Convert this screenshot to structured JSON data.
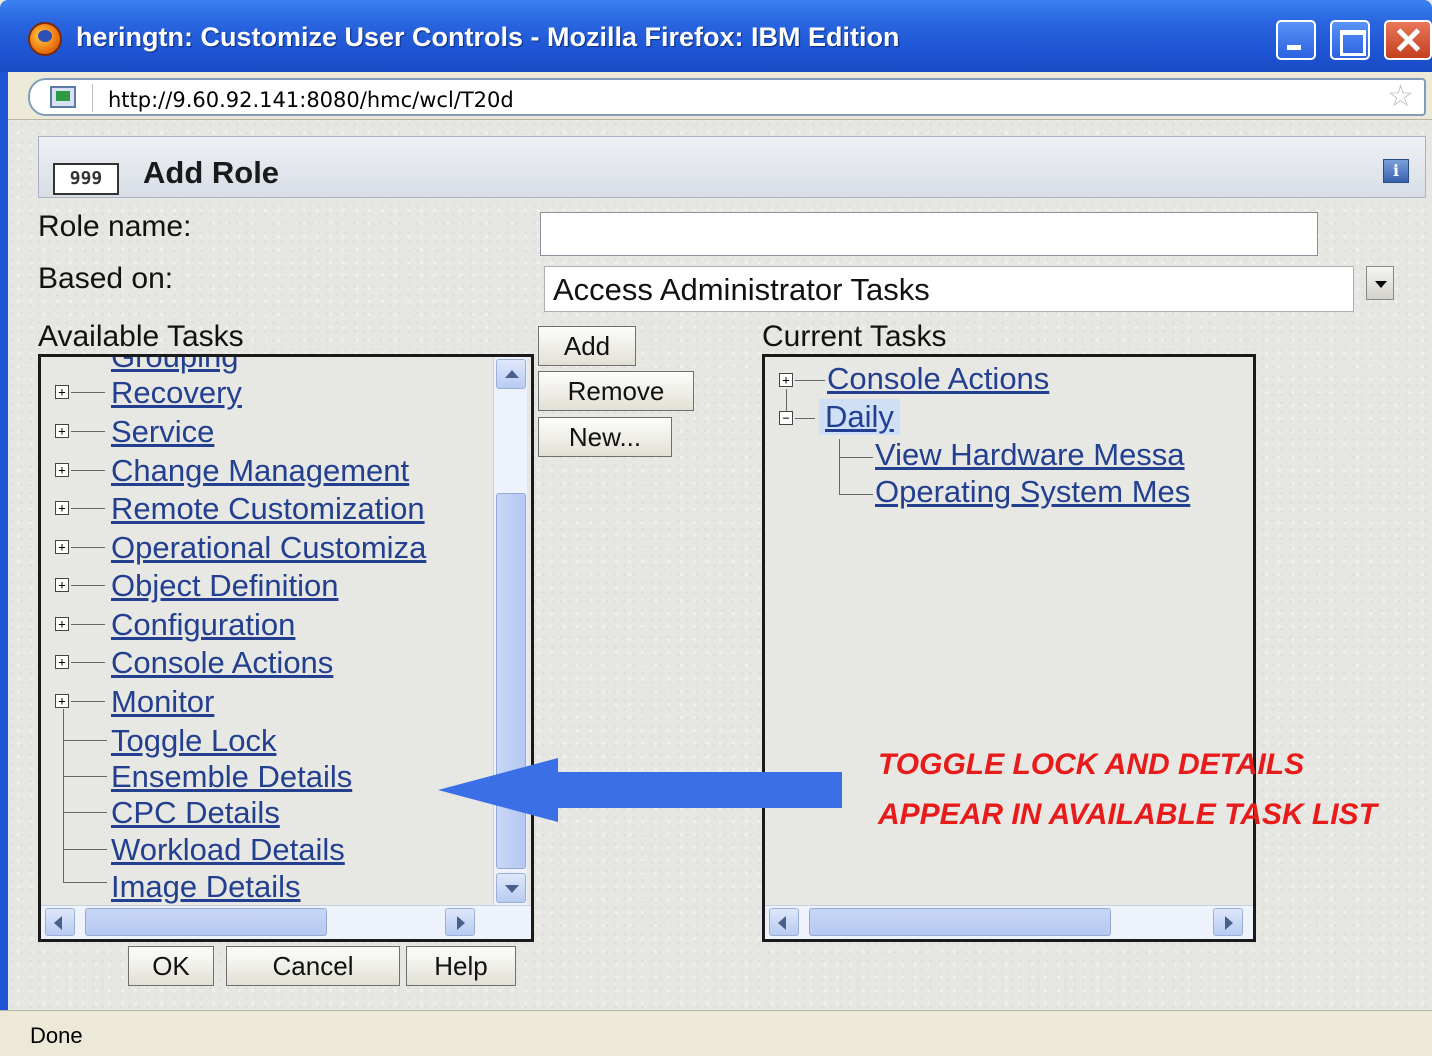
{
  "window": {
    "title": "heringtn: Customize User Controls - Mozilla Firefox: IBM Edition"
  },
  "urlbar": {
    "url": "http://9.60.92.141:8080/hmc/wcl/T20d"
  },
  "dialog": {
    "header_title": "Add Role",
    "role_icon_text": "999",
    "role_name_label": "Role name:",
    "role_name_value": "",
    "based_on_label": "Based on:",
    "based_on_value": "Access Administrator Tasks",
    "available_label": "Available Tasks",
    "current_label": "Current Tasks",
    "available_items": [
      "Grouping",
      "Recovery",
      "Service",
      "Change Management",
      "Remote Customization",
      "Operational Customiza",
      "Object Definition",
      "Configuration",
      "Console Actions",
      "Monitor",
      "Toggle Lock",
      "Ensemble Details",
      "CPC Details",
      "Workload Details",
      "Image Details"
    ],
    "current_items": [
      "Console Actions",
      "Daily",
      "View Hardware Messa",
      "Operating System Mes"
    ],
    "buttons": {
      "add": "Add",
      "remove": "Remove",
      "new": "New...",
      "ok": "OK",
      "cancel": "Cancel",
      "help": "Help"
    }
  },
  "annotation": {
    "line1": "TOGGLE LOCK AND DETAILS",
    "line2": "APPEAR IN AVAILABLE TASK LIST",
    "color": "#e81b1b",
    "arrow_color": "#3a6fe6"
  },
  "status": {
    "text": "Done"
  },
  "icons": [
    "firefox-icon",
    "site-icon",
    "bookmark-star-icon",
    "role-keys-icon",
    "info-icon"
  ]
}
